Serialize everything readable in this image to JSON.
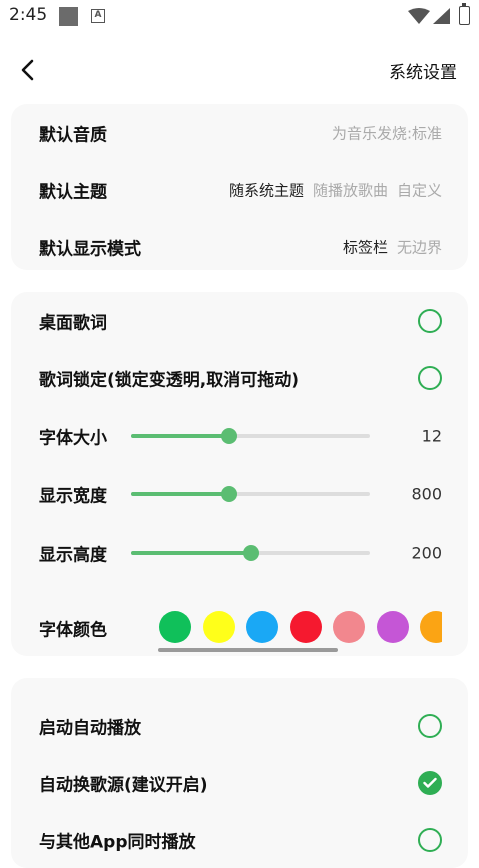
{
  "status_bar": {
    "time": "2:45",
    "notification_letter": "A"
  },
  "header": {
    "title": "系统设置"
  },
  "quality_card": {
    "default_quality": {
      "label": "默认音质",
      "value": "为音乐发烧:标准"
    },
    "default_theme": {
      "label": "默认主题",
      "options": [
        "随系统主题",
        "随播放歌曲",
        "自定义"
      ],
      "selected": 0
    },
    "default_display_mode": {
      "label": "默认显示模式",
      "options": [
        "标签栏",
        "无边界"
      ],
      "selected": 0
    }
  },
  "lyrics_card": {
    "desktop_lyrics": {
      "label": "桌面歌词",
      "checked": false
    },
    "lyrics_lock": {
      "label": "歌词锁定(锁定变透明,取消可拖动)",
      "checked": false
    },
    "font_size": {
      "label": "字体大小",
      "value": "12",
      "fraction": 0.41
    },
    "display_width": {
      "label": "显示宽度",
      "value": "800",
      "fraction": 0.41
    },
    "display_height": {
      "label": "显示高度",
      "value": "200",
      "fraction": 0.5
    },
    "font_color": {
      "label": "字体颜色",
      "colors": [
        "#10c05a",
        "#ffff1a",
        "#1aa8f5",
        "#f5192f",
        "#f2878e",
        "#c556d6",
        "#fba414"
      ]
    }
  },
  "playback_card": {
    "auto_play": {
      "label": "启动自动播放",
      "checked": false
    },
    "auto_switch_source": {
      "label": "自动换歌源(建议开启)",
      "checked": true
    },
    "mix_with_others": {
      "label": "与其他App同时播放",
      "checked": false
    }
  },
  "colors": {
    "accent": "#2fae54",
    "slider": "#5bbd72",
    "card_bg": "#f8f8f8"
  }
}
